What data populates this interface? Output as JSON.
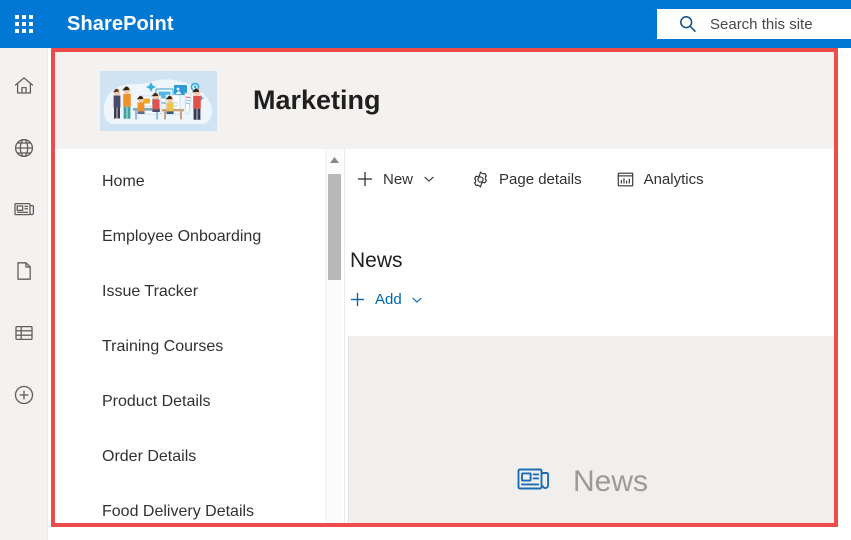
{
  "suite": {
    "app_launcher_icon": "waffle-grid-icon",
    "brand": "SharePoint",
    "header_color": "#0078d4",
    "search": {
      "icon": "search-icon",
      "placeholder": "Search this site",
      "value": ""
    }
  },
  "app_rail": {
    "items": [
      {
        "icon": "home-icon",
        "label": "Home"
      },
      {
        "icon": "globe-icon",
        "label": "My sites"
      },
      {
        "icon": "news-icon",
        "label": "News"
      },
      {
        "icon": "page-icon",
        "label": "Files"
      },
      {
        "icon": "list-icon",
        "label": "Lists"
      },
      {
        "icon": "plus-circle-icon",
        "label": "Create"
      }
    ]
  },
  "annotation": {
    "color": "#ee4b4b",
    "shape": "rectangle-highlight"
  },
  "site": {
    "logo_icon": "marketing-team-illustration",
    "title": "Marketing"
  },
  "nav": {
    "items": [
      {
        "label": "Home"
      },
      {
        "label": "Employee Onboarding"
      },
      {
        "label": "Issue Tracker"
      },
      {
        "label": "Training Courses"
      },
      {
        "label": "Product Details"
      },
      {
        "label": "Order Details"
      },
      {
        "label": "Food Delivery Details"
      }
    ],
    "scrollbar": {
      "up_arrow_icon": "chevron-up-icon",
      "thumb_color": "#b8b8b8"
    }
  },
  "command_bar": {
    "new": {
      "icon": "plus-icon",
      "label": "New",
      "chevron": "chevron-down-icon"
    },
    "page_details": {
      "icon": "gear-icon",
      "label": "Page details"
    },
    "analytics": {
      "icon": "analytics-chart-icon",
      "label": "Analytics"
    }
  },
  "news_section": {
    "heading": "News",
    "add": {
      "icon": "plus-icon",
      "label": "Add",
      "chevron": "chevron-down-icon"
    },
    "placeholder": {
      "icon": "news-webpart-icon",
      "label": "News"
    },
    "link_color": "#0064ad"
  }
}
